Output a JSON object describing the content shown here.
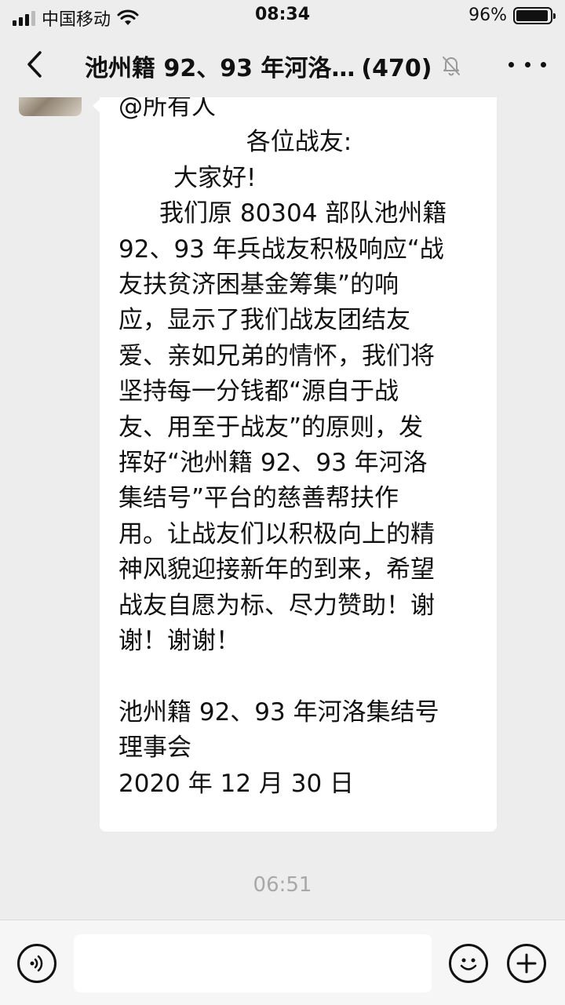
{
  "status_bar": {
    "carrier": "中国移动",
    "time": "08:34",
    "battery_percent": "96%",
    "battery_level": 0.96,
    "icons": [
      "signal-icon",
      "wifi-icon",
      "battery-icon"
    ]
  },
  "header": {
    "title": "池州籍 92、93 年河洛…",
    "member_count": "(470)",
    "icons": [
      "back-icon",
      "mute-bell-icon",
      "more-icon"
    ]
  },
  "message": {
    "lines": [
      "@所有人",
      "各位战友:",
      "大家好!",
      "我们原 80304 部队池州籍",
      "92、93 年兵战友积极响应“战",
      "友扶贫济困基金筹集”的响",
      "应，显示了我们战友团结友",
      "爱、亲如兄弟的情怀，我们将",
      "坚持每一分钱都“源自于战",
      "友、用至于战友”的原则，发",
      "挥好“池州籍 92、93 年河洛",
      "集结号”平台的慈善帮扶作",
      "用。让战友们以积极向上的精",
      "神风貌迎接新年的到来，希望",
      "战友自愿为标、尽力赞助！谢",
      "谢！谢谢！",
      "",
      "池州籍 92、93 年河洛集结号",
      "理事会",
      "2020 年 12 月 30 日"
    ]
  },
  "timestamp": "06:51",
  "input_bar": {
    "icons": [
      "voice-icon",
      "emoji-icon",
      "plus-icon"
    ]
  },
  "colors": {
    "background": "#ededed",
    "bubble": "#ffffff",
    "timestamp": "#a8a8a8"
  }
}
